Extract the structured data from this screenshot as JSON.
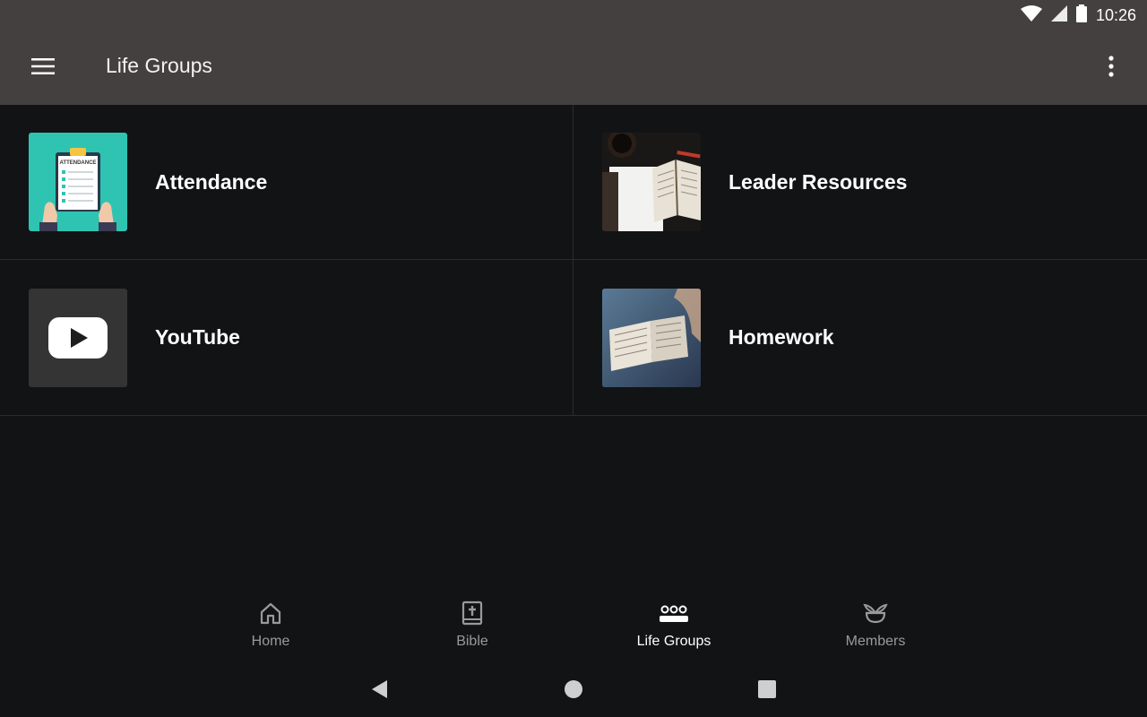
{
  "status": {
    "time": "10:26"
  },
  "toolbar": {
    "title": "Life Groups"
  },
  "tiles": [
    {
      "label": "Attendance",
      "thumb_text": "ATTENDANCE"
    },
    {
      "label": "Leader Resources"
    },
    {
      "label": "YouTube"
    },
    {
      "label": "Homework"
    }
  ],
  "bottom_nav": [
    {
      "label": "Home",
      "icon": "home-icon",
      "active": false
    },
    {
      "label": "Bible",
      "icon": "bible-icon",
      "active": false
    },
    {
      "label": "Life Groups",
      "icon": "groups-icon",
      "active": true
    },
    {
      "label": "Members",
      "icon": "members-icon",
      "active": false
    }
  ],
  "colors": {
    "toolbar_bg": "#444040",
    "background": "#121315",
    "nav_inactive": "#9a9a9a",
    "nav_active": "#ffffff",
    "attendance_bg": "#2fc4b2"
  }
}
